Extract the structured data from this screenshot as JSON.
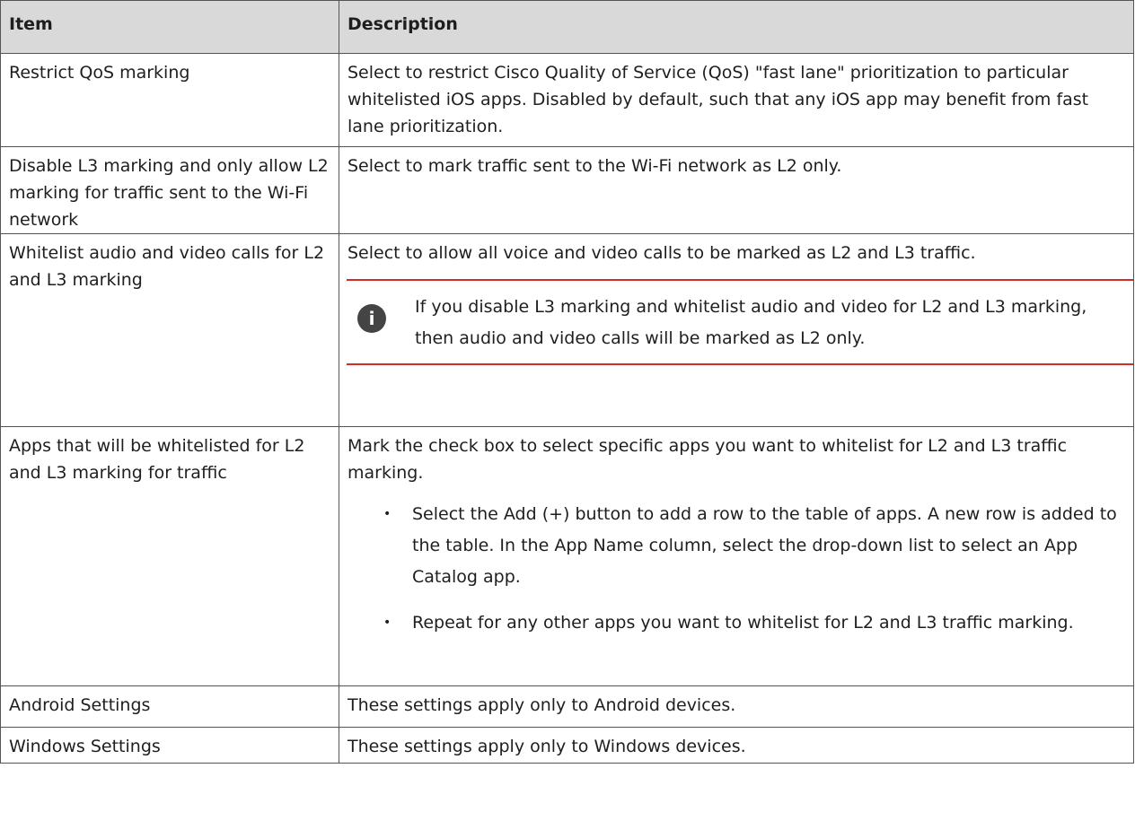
{
  "table": {
    "headers": {
      "item": "Item",
      "description": "Description"
    },
    "rows": [
      {
        "item": "Restrict QoS marking",
        "description": "Select to restrict Cisco Quality of Service (QoS) \"fast lane\" prioritization to particular whitelisted iOS apps. Disabled by default, such that any iOS app may benefit from fast lane prioritization."
      },
      {
        "item": "Disable L3 marking and only allow L2 marking for traffic sent to the Wi-Fi network",
        "description": "Select to mark traffic sent to the Wi-Fi network as L2 only."
      },
      {
        "item": "Whitelist audio and video calls for L2 and L3 marking",
        "description": "Select to allow all voice and video calls to be marked as L2 and L3 traffic.",
        "note": "If you disable L3 marking and whitelist audio and video for L2 and L3 marking, then audio and video calls will be marked as L2 only."
      },
      {
        "item": "Apps that will be whitelisted for L2 and L3 marking for traffic",
        "description": "Mark the check box to select specific apps you want to whitelist for L2 and L3 traffic marking.",
        "bullets": [
          "Select the Add (+) button to add a row to the table of apps. A new row is added to the table. In the App Name column, select the drop-down list to select an App Catalog app.",
          "Repeat for any other apps you want to whitelist for L2 and L3 traffic marking."
        ]
      },
      {
        "item": "Android Settings",
        "description": "These settings apply only to Android devices."
      },
      {
        "item": "Windows Settings",
        "description": "These settings apply only to Windows devices."
      }
    ]
  },
  "icons": {
    "note": "info-icon",
    "bullet": "•"
  },
  "colors": {
    "header_bg": "#d9d9d9",
    "note_rule": "#d22b2b",
    "border": "#555555",
    "info_icon_bg": "#444444"
  }
}
